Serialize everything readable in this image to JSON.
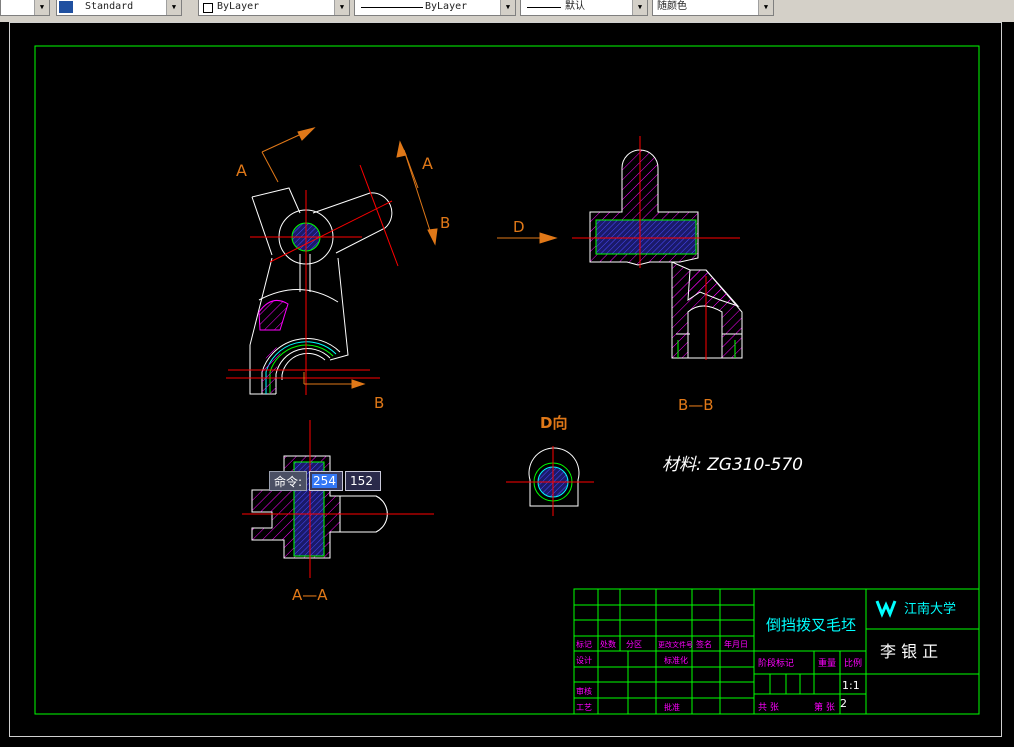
{
  "toolbar": {
    "textstyle": "Standard",
    "layer": "ByLayer",
    "linetype": "ByLayer",
    "lineweight": "默认",
    "color": "随颜色"
  },
  "drawing": {
    "labels": {
      "section_a": "A",
      "section_a2": "A",
      "section_b": "B",
      "section_b2": "B",
      "d_arrow": "D",
      "view_bb": "B—B",
      "view_d": "D向",
      "view_aa": "A—A",
      "material": "材料: ZG310-570"
    },
    "title_block": {
      "part_name": "倒挡拨叉毛坯",
      "school": "江南大学",
      "author": "李 银 正",
      "scale_header": "比例",
      "mass_header": "重量",
      "stage_header": "阶段标记",
      "scale_value": "1:1",
      "sheet_value": "2",
      "row_headers": [
        "标记",
        "处数",
        "分区",
        "更改文件号",
        "签名",
        "年月日"
      ],
      "designer": "设计",
      "standard": "标准化",
      "audit": "审核",
      "process": "工艺",
      "approve": "批准",
      "sheets": "共 张",
      "sheet_of": "第 张"
    }
  },
  "command": {
    "label": "命令:",
    "value1": "254",
    "value2": "152"
  },
  "colors": {
    "green": "#00ff00",
    "red": "#ff0000",
    "orange": "#e07818",
    "magenta": "#ff00ff",
    "blue": "#3030c0",
    "cyan": "#00ffff"
  }
}
